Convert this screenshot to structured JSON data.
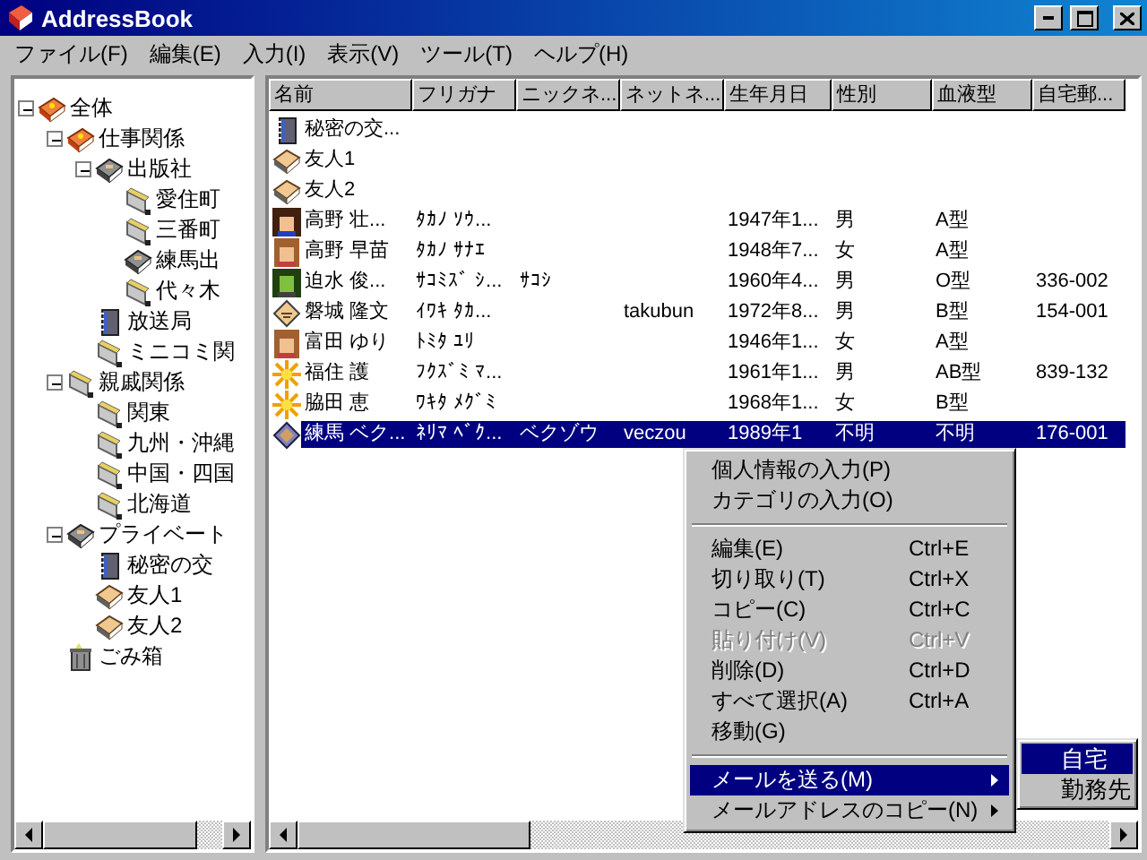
{
  "window": {
    "title": "AddressBook"
  },
  "menu_bar": [
    "ファイル(F)",
    "編集(E)",
    "入力(I)",
    "表示(V)",
    "ツール(T)",
    "ヘルプ(H)"
  ],
  "tree": [
    {
      "label": "全体",
      "kind": "book-orange",
      "expanded": true,
      "children": [
        {
          "label": "仕事関係",
          "kind": "book-orange",
          "expanded": true,
          "children": [
            {
              "label": "出版社",
              "kind": "book-gray",
              "expanded": true,
              "children": [
                {
                  "label": "愛住町",
                  "kind": "folder"
                },
                {
                  "label": "三番町",
                  "kind": "folder"
                },
                {
                  "label": "練馬出",
                  "kind": "book-gray"
                },
                {
                  "label": "代々木",
                  "kind": "folder"
                }
              ]
            },
            {
              "label": "放送局",
              "kind": "notebook"
            },
            {
              "label": "ミニコミ関",
              "kind": "folder"
            }
          ]
        },
        {
          "label": "親戚関係",
          "kind": "folder",
          "expanded": true,
          "children": [
            {
              "label": "関東",
              "kind": "folder"
            },
            {
              "label": "九州・沖縄",
              "kind": "folder"
            },
            {
              "label": "中国・四国",
              "kind": "folder"
            },
            {
              "label": "北海道",
              "kind": "folder"
            }
          ]
        },
        {
          "label": "プライベート",
          "kind": "book-gray",
          "expanded": true,
          "children": [
            {
              "label": "秘密の交",
              "kind": "notebook"
            },
            {
              "label": "友人1",
              "kind": "book-tan"
            },
            {
              "label": "友人2",
              "kind": "book-tan"
            }
          ]
        },
        {
          "label": "ごみ箱",
          "kind": "trash"
        }
      ]
    }
  ],
  "table": {
    "columns": [
      "名前",
      "フリガナ",
      "ニックネ...",
      "ネットネ...",
      "生年月日",
      "性別",
      "血液型",
      "自宅郵..."
    ],
    "rows": [
      {
        "kind": "notebook",
        "selected": false,
        "cells": [
          "秘密の交...",
          "",
          "",
          "",
          "",
          "",
          "",
          ""
        ]
      },
      {
        "kind": "book-tan",
        "selected": false,
        "cells": [
          "友人1",
          "",
          "",
          "",
          "",
          "",
          "",
          ""
        ]
      },
      {
        "kind": "book-tan",
        "selected": false,
        "cells": [
          "友人2",
          "",
          "",
          "",
          "",
          "",
          "",
          ""
        ]
      },
      {
        "kind": "person-dark",
        "selected": false,
        "cells": [
          "高野 壮...",
          "ﾀｶﾉ ｿｳ...",
          "",
          "",
          "1947年1...",
          "男",
          "A型",
          ""
        ]
      },
      {
        "kind": "person-brown",
        "selected": false,
        "cells": [
          "高野 早苗",
          "ﾀｶﾉ ｻﾅｴ",
          "",
          "",
          "1948年7...",
          "女",
          "A型",
          ""
        ]
      },
      {
        "kind": "person-green",
        "selected": false,
        "cells": [
          "迫水 俊...",
          "ｻｺﾐｽﾞ ｼ...",
          "ｻｺｼ",
          "",
          "1960年4...",
          "男",
          "O型",
          "336-002"
        ]
      },
      {
        "kind": "card",
        "selected": false,
        "cells": [
          "磐城 隆文",
          "ｲﾜｷ ﾀｶ...",
          "",
          "takubun",
          "1972年8...",
          "男",
          "B型",
          "154-001"
        ]
      },
      {
        "kind": "person-brown",
        "selected": false,
        "cells": [
          "富田 ゆり",
          "ﾄﾐﾀ ﾕﾘ",
          "",
          "",
          "1946年1...",
          "女",
          "A型",
          ""
        ]
      },
      {
        "kind": "star",
        "selected": false,
        "cells": [
          "福住 護",
          "ﾌｸｽﾞﾐ ﾏ...",
          "",
          "",
          "1961年1...",
          "男",
          "AB型",
          "839-132"
        ]
      },
      {
        "kind": "star",
        "selected": false,
        "cells": [
          "脇田 恵",
          "ﾜｷﾀ ﾒｸﾞﾐ",
          "",
          "",
          "1968年1...",
          "女",
          "B型",
          ""
        ]
      },
      {
        "kind": "card-blue",
        "selected": true,
        "cells": [
          "練馬 ベク...",
          "ﾈﾘﾏ ﾍﾞｸ...",
          "ベクゾウ",
          "veczou",
          "1989年1",
          "不明",
          "不明",
          "176-001"
        ]
      }
    ]
  },
  "context_menu": {
    "items": [
      {
        "kind": "item",
        "label": "個人情報の入力(P)",
        "disabled": false,
        "selected": false
      },
      {
        "kind": "item",
        "label": "カテゴリの入力(O)",
        "disabled": false,
        "selected": false
      },
      {
        "kind": "separator"
      },
      {
        "kind": "item",
        "label": "編集(E)",
        "shortcut": "Ctrl+E",
        "disabled": false,
        "selected": false
      },
      {
        "kind": "item",
        "label": "切り取り(T)",
        "shortcut": "Ctrl+X",
        "disabled": false,
        "selected": false
      },
      {
        "kind": "item",
        "label": "コピー(C)",
        "shortcut": "Ctrl+C",
        "disabled": false,
        "selected": false
      },
      {
        "kind": "item",
        "label": "貼り付け(V)",
        "shortcut": "Ctrl+V",
        "disabled": true,
        "selected": false
      },
      {
        "kind": "item",
        "label": "削除(D)",
        "shortcut": "Ctrl+D",
        "disabled": false,
        "selected": false
      },
      {
        "kind": "item",
        "label": "すべて選択(A)",
        "shortcut": "Ctrl+A",
        "disabled": false,
        "selected": false
      },
      {
        "kind": "item",
        "label": "移動(G)",
        "disabled": false,
        "selected": false
      },
      {
        "kind": "separator"
      },
      {
        "kind": "submenu",
        "label": "メールを送る(M)",
        "disabled": false,
        "selected": true
      },
      {
        "kind": "submenu",
        "label": "メールアドレスのコピー(N)",
        "disabled": false,
        "selected": false
      }
    ],
    "submenu": [
      {
        "label": "自宅",
        "selected": true
      },
      {
        "label": "勤務先",
        "selected": false
      }
    ]
  }
}
